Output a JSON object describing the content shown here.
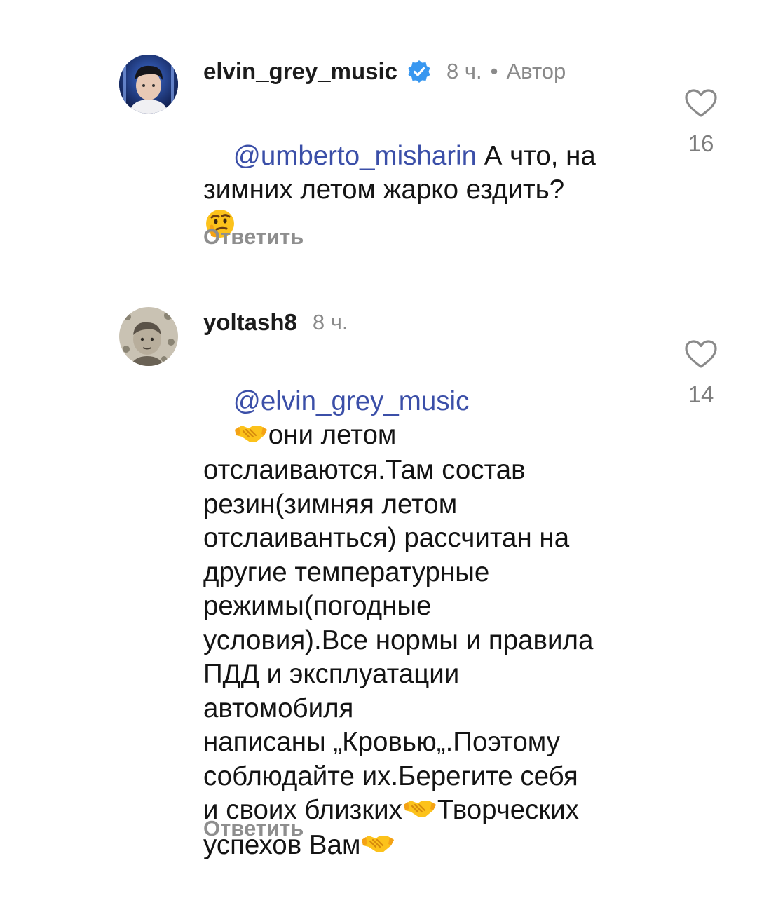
{
  "comments": [
    {
      "username": "elvin_grey_music",
      "verified": true,
      "time": "8 ч.",
      "separator": "•",
      "author_badge": "Автор",
      "mention": "@umberto_misharin",
      "text_line1": " А что, на",
      "text_line2": "зимних летом жарко ездить?",
      "emoji": "thinking-face",
      "reply_label": "Ответить",
      "likes": "16",
      "liked": false
    },
    {
      "username": "yoltash8",
      "verified": false,
      "time": "8 ч.",
      "mention": "@elvin_grey_music",
      "lines": [
        "они летом",
        "отслаиваются.Там состав",
        "резин(зимняя летом",
        "отслаиванться) рассчитан на",
        "другие температурные",
        "режимы(погодные",
        "условия).Все нормы и правила",
        "ПДД и эксплуатации",
        "автомобиля",
        "написаны „Кровью„.Поэтому",
        "соблюдайте их.Берегите себя",
        "и своих близких",
        "Творческих",
        "успехов Вам"
      ],
      "emoji": "handshake",
      "reply_label": "Ответить",
      "likes": "14",
      "liked": false
    }
  ],
  "colors": {
    "mention": "#3b4fa8",
    "muted": "#8a8a8a",
    "verified": "#3897f0"
  }
}
